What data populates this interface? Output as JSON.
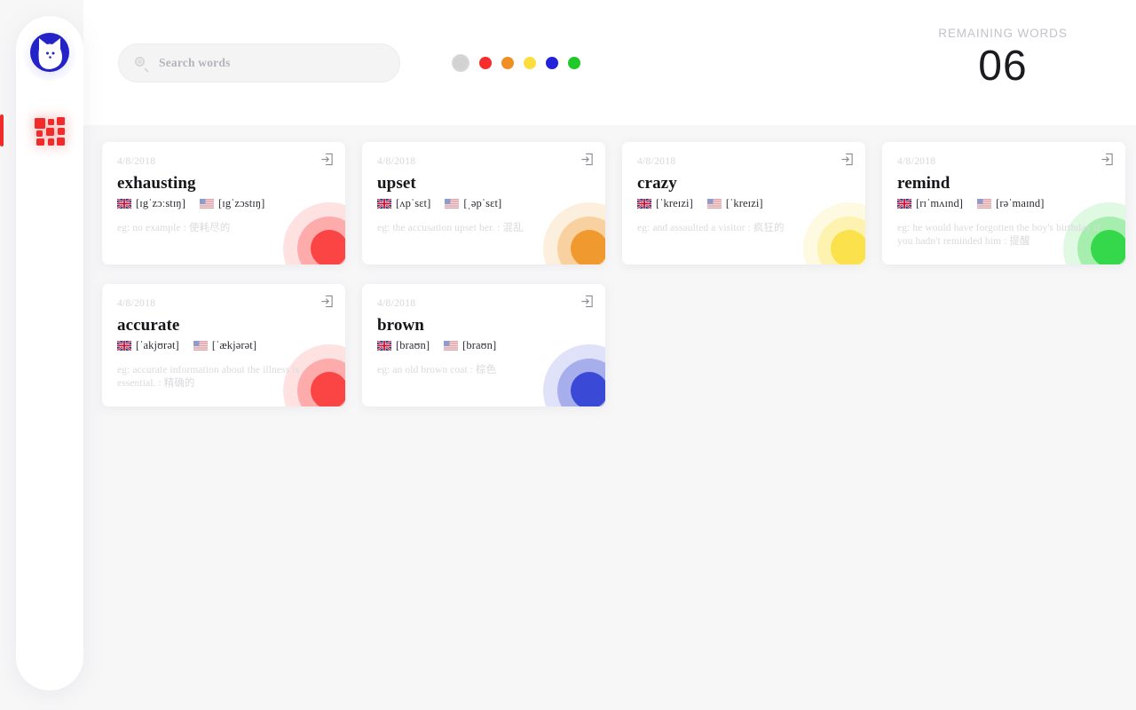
{
  "app": {
    "logo_icon": "cat-logo-icon",
    "accent_color": "#f12a2a",
    "logo_color": "#2323c8"
  },
  "sidebar": {
    "items": [
      {
        "label": "Dashboard",
        "icon": "grid-dashboard-icon",
        "active": true
      }
    ]
  },
  "header": {
    "search": {
      "icon": "search-icon",
      "placeholder": "Search words",
      "value": ""
    },
    "color_filters": [
      {
        "name": "all",
        "color": "#d2d2d2",
        "selected": true
      },
      {
        "name": "red",
        "color": "#f72c2c",
        "selected": false
      },
      {
        "name": "orange",
        "color": "#ef8f23",
        "selected": false
      },
      {
        "name": "yellow",
        "color": "#fbde3e",
        "selected": false
      },
      {
        "name": "blue",
        "color": "#2222da",
        "selected": false
      },
      {
        "name": "green",
        "color": "#1fc92a",
        "selected": false
      }
    ],
    "remaining": {
      "label": "REMAINING WORDS",
      "count": "06"
    }
  },
  "cards": [
    {
      "date": "4/8/2018",
      "word": "exhausting",
      "uk_flag": "uk-flag-icon",
      "uk_phonetic": "[ɪgˈzɔːstɪŋ]",
      "us_flag": "us-flag-icon",
      "us_phonetic": "[ɪgˈzɔstɪŋ]",
      "example": "eg: no example : 使耗尽的",
      "color": "#fb4444",
      "corner_icon": "enter-arrow-icon"
    },
    {
      "date": "4/8/2018",
      "word": "upset",
      "uk_flag": "uk-flag-icon",
      "uk_phonetic": "[ʌpˈsɛt]",
      "us_flag": "us-flag-icon",
      "us_phonetic": "[ˌəpˈsɛt]",
      "example": "eg: the accusation upset her. : 混乱",
      "color": "#f0992e",
      "corner_icon": "enter-arrow-icon"
    },
    {
      "date": "4/8/2018",
      "word": "crazy",
      "uk_flag": "uk-flag-icon",
      "uk_phonetic": "[ˈkreɪzi]",
      "us_flag": "us-flag-icon",
      "us_phonetic": "[ˈkreɪzi]",
      "example": "eg: and assaulted a visitor : 疯狂的",
      "color": "#fbe14b",
      "corner_icon": "enter-arrow-icon"
    },
    {
      "date": "4/8/2018",
      "word": "remind",
      "uk_flag": "uk-flag-icon",
      "uk_phonetic": "[rɪˈmʌɪnd]",
      "us_flag": "us-flag-icon",
      "us_phonetic": "[rəˈmaɪnd]",
      "example": "eg: he would have forgotten the boy's birthday if you hadn't reminded him : 提醒",
      "color": "#35d84a",
      "corner_icon": "enter-arrow-icon"
    },
    {
      "date": "4/8/2018",
      "word": "accurate",
      "uk_flag": "uk-flag-icon",
      "uk_phonetic": "[ˈakjʊrət]",
      "us_flag": "us-flag-icon",
      "us_phonetic": "[ˈækjərət]",
      "example": "eg: accurate information about the illness is essential. : 精确的",
      "color": "#fb4444",
      "corner_icon": "enter-arrow-icon"
    },
    {
      "date": "4/8/2018",
      "word": "brown",
      "uk_flag": "uk-flag-icon",
      "uk_phonetic": "[braʊn]",
      "us_flag": "us-flag-icon",
      "us_phonetic": "[braʊn]",
      "example": "eg: an old brown coat : 棕色",
      "color": "#3a49d6",
      "corner_icon": "enter-arrow-icon"
    }
  ]
}
